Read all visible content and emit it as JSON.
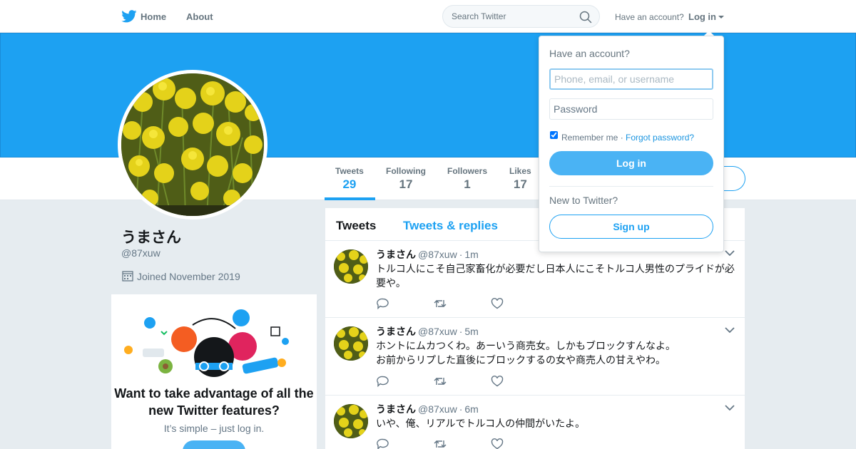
{
  "nav": {
    "home_label": "Home",
    "about_label": "About",
    "search_placeholder": "Search Twitter",
    "have_account": "Have an account?",
    "login_label": "Log in"
  },
  "colors": {
    "brand": "#1da1f2",
    "text_secondary": "#657786"
  },
  "profile": {
    "name": "うまさん",
    "handle": "@87xuw",
    "joined": "Joined November 2019"
  },
  "stats": [
    {
      "label": "Tweets",
      "value": "29",
      "active": true
    },
    {
      "label": "Following",
      "value": "17",
      "active": false
    },
    {
      "label": "Followers",
      "value": "1",
      "active": false
    },
    {
      "label": "Likes",
      "value": "17",
      "active": false
    }
  ],
  "promo": {
    "title": "Want to take advantage of all the new Twitter features?",
    "subtitle": "It’s simple – just log in."
  },
  "timeline": {
    "tab_tweets": "Tweets",
    "tab_replies": "Tweets & replies",
    "tweets": [
      {
        "name": "うまさん",
        "handle": "@87xuw",
        "sep": "·",
        "time": "1m",
        "text": "トルコ人にこそ自己家畜化が必要だし日本人にこそトルコ人男性のプライドが必要や。"
      },
      {
        "name": "うまさん",
        "handle": "@87xuw",
        "sep": "·",
        "time": "5m",
        "text_line1": "ホントにムカつくわ。あーいう商売女。しかもブロックすんなよ。",
        "text_line2": "お前からリプした直後にブロックするの女や商売人の甘えやわ。"
      },
      {
        "name": "うまさん",
        "handle": "@87xuw",
        "sep": "·",
        "time": "6m",
        "text": "いや、俺、リアルでトルコ人の仲間がいたよ。"
      }
    ]
  },
  "login_dropdown": {
    "title": "Have an account?",
    "username_placeholder": "Phone, email, or username",
    "password_placeholder": "Password",
    "remember": "Remember me",
    "remember_sep": " · ",
    "forgot": "Forgot password?",
    "login_button": "Log in",
    "new_to_twitter": "New to Twitter?",
    "signup_button": "Sign up"
  }
}
